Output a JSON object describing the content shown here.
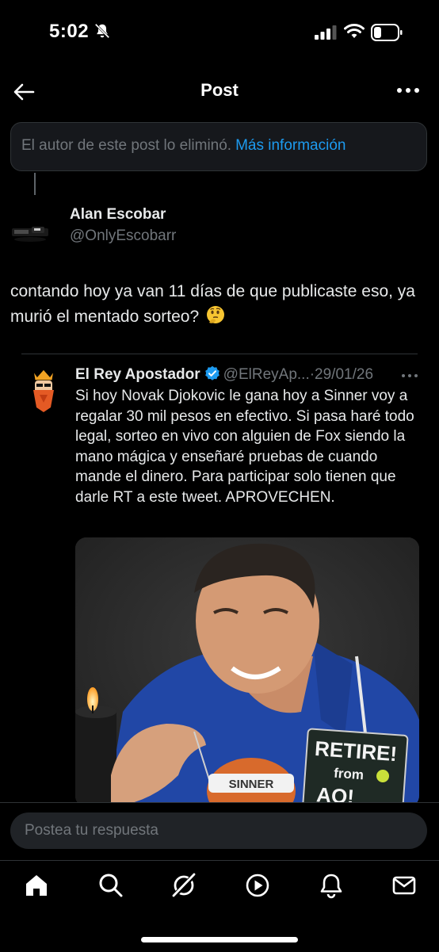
{
  "status_bar": {
    "time": "5:02"
  },
  "header": {
    "title": "Post"
  },
  "deleted_notice": {
    "text": "El autor de este post lo eliminó.",
    "link": "Más información"
  },
  "post": {
    "author_name": "Alan Escobar",
    "author_handle": "@OnlyEscobarr",
    "text": "contando hoy ya van 11 días de que publicaste eso, ya murió el mentado sorteo?",
    "emoji": "thinking-face"
  },
  "quoted_post": {
    "author_name": "El Rey Apostador",
    "author_handle": "@ElReyAp...",
    "separator": "·",
    "date": "29/01/26",
    "text": "Si hoy Novak Djokovic le gana hoy a Sinner voy a regalar 30 mil pesos en efectivo. Si pasa haré todo legal, sorteo en vivo con alguien de Fox siendo la mano mágica y enseñaré pruebas de cuando mande el dinero. Para participar solo tienen que darle RT a este tweet. APROVECHEN.",
    "media": {
      "sign_line1": "RETIRE!",
      "sign_line2": "from",
      "sign_line3": "AO!",
      "headband": "SINNER"
    }
  },
  "reply": {
    "placeholder": "Postea tu respuesta"
  },
  "colors": {
    "accent": "#1d9bf0",
    "background": "#000000",
    "muted": "#71767b"
  },
  "nav": [
    "home-icon",
    "search-icon",
    "grok-icon",
    "video-icon",
    "notifications-icon",
    "messages-icon"
  ]
}
